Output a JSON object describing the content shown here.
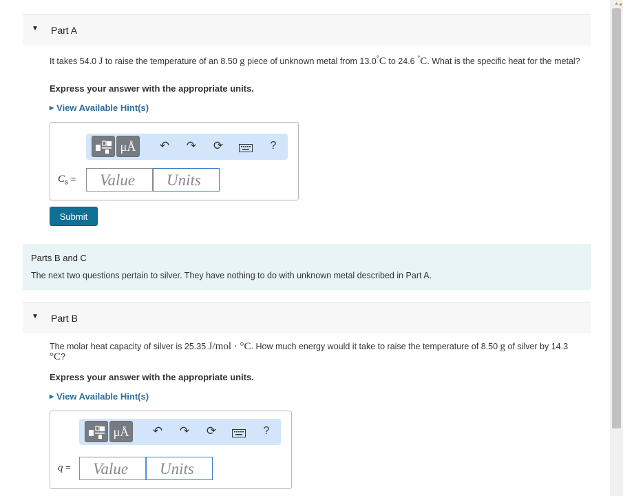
{
  "part_a": {
    "title": "Part A",
    "question_pre": "It takes 54.0 ",
    "q_unit_j": "J",
    "question_mid1": " to raise the temperature of an 8.50 ",
    "q_unit_g": "g",
    "question_mid2": " piece of unknown metal from 13.0",
    "q_deg1": "°",
    "q_unit_c1": "C",
    "question_mid3": " to 24.6 ",
    "q_deg2": "°",
    "q_unit_c2": "C",
    "question_post": ". What is the specific heat for the metal?",
    "instruction": "Express your answer with the appropriate units.",
    "hint_link": "View Available Hint(s)",
    "var_symbol": "C",
    "var_sub": "s",
    "var_eq": " =",
    "value_placeholder": "Value",
    "units_placeholder": "Units",
    "submit_label": "Submit"
  },
  "toolbar": {
    "units_button": "μÅ",
    "undo_icon": "undo-icon",
    "redo_icon": "redo-icon",
    "reset_icon": "reset-icon",
    "keyboard_icon": "keyboard-icon",
    "help_label": "?"
  },
  "parts_bc": {
    "title": "Parts B and C",
    "body": "The next two questions pertain to silver. They have nothing to do with unknown metal described in Part A."
  },
  "part_b": {
    "title": "Part B",
    "question_pre": "The molar heat capacity of silver is 25.35 ",
    "q_unit": "J/mol · °C",
    "question_mid": ". How much energy would it take to raise the temperature of 8.50 ",
    "q_unit_g": "g",
    "question_mid2": " of silver by 14.3 ",
    "q_unit_c": "°C",
    "question_post": "?",
    "instruction": "Express your answer with the appropriate units.",
    "hint_link": "View Available Hint(s)",
    "var_symbol": "q",
    "var_eq": " =",
    "value_placeholder": "Value",
    "units_placeholder": "Units"
  },
  "colors": {
    "accent": "#0f7094",
    "link": "#2b6e99",
    "toolbar_bg": "#d2e5fa",
    "info_bg": "#e8f4f6"
  }
}
